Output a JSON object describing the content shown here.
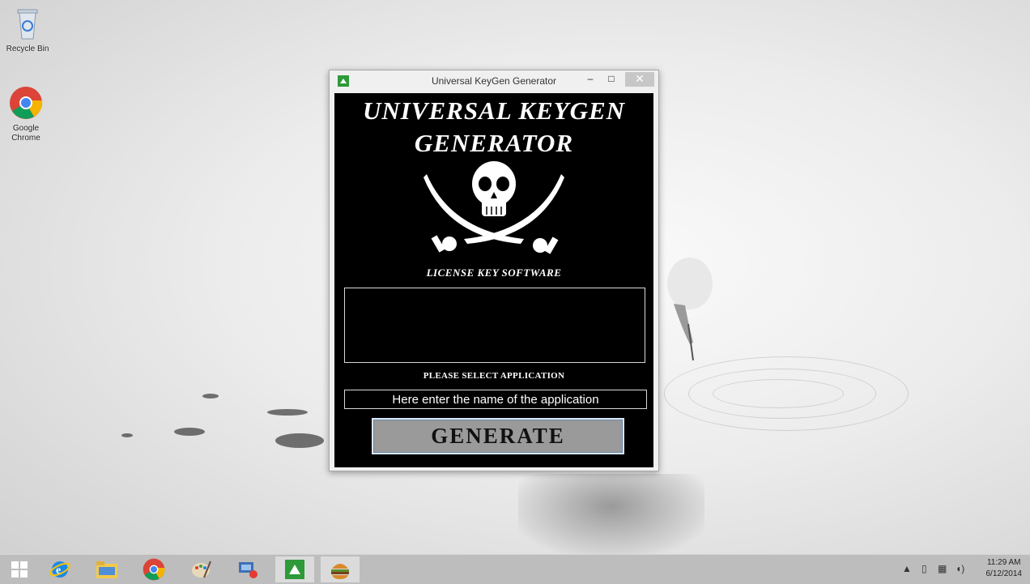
{
  "desktop": {
    "icons": [
      {
        "label": "Recycle Bin"
      },
      {
        "label": "Google Chrome"
      }
    ]
  },
  "window": {
    "title": "Universal KeyGen Generator",
    "controls": {
      "minimize": "–",
      "maximize": "□",
      "close": "✕"
    },
    "heading_line1": "UNIVERSAL KEYGEN",
    "heading_line2": "GENERATOR",
    "subtitle": "LICENSE KEY SOFTWARE",
    "output_text": "",
    "select_label": "PLEASE SELECT APPLICATION",
    "app_input": {
      "value": "",
      "placeholder": "Here enter the name of the application"
    },
    "generate_label": "GENERATE"
  },
  "taskbar": {
    "items": [
      "start",
      "internet-explorer",
      "file-explorer",
      "chrome",
      "paint",
      "control-panel",
      "keygen-app",
      "burger-app"
    ],
    "clock": {
      "time": "11:29 AM",
      "date": "6/12/2014"
    }
  }
}
